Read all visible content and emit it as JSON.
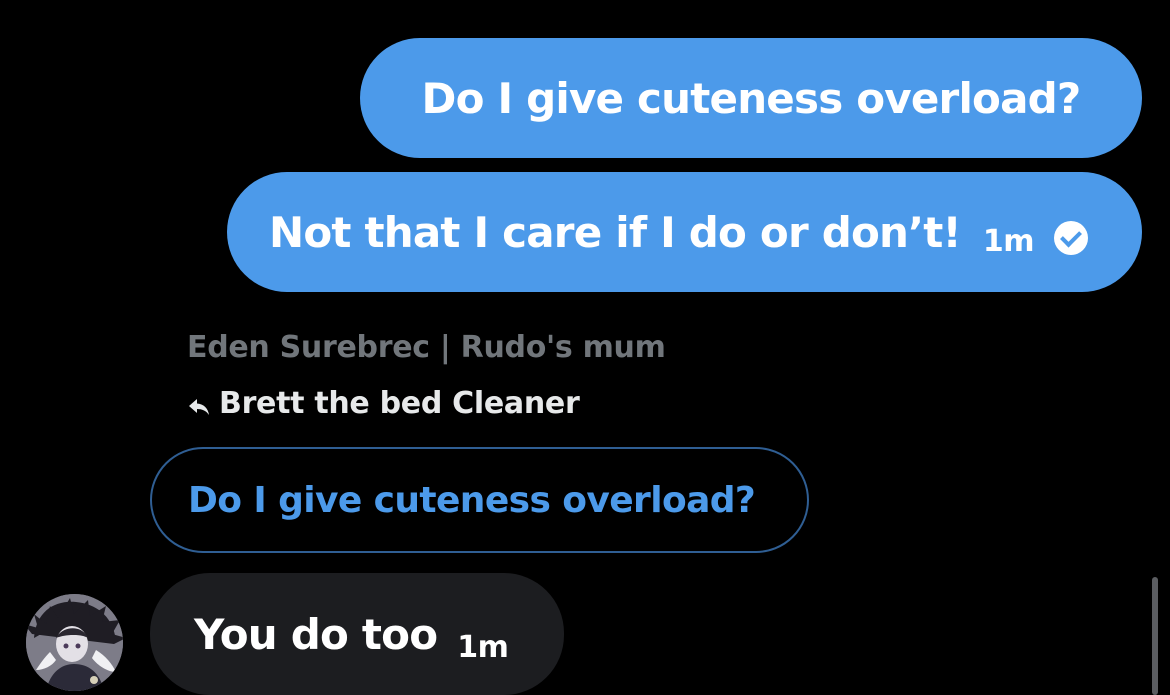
{
  "conversation": {
    "sent_messages": [
      {
        "text": "Do I give cuteness overload?"
      },
      {
        "text": "Not that I care if I do or don’t!",
        "time": "1m",
        "status_icon": "check-circle-icon"
      }
    ],
    "reply_block": {
      "sender": "Eden Surebrec | Rudo's mum",
      "reply_to_name": "Brett the bed Cleaner",
      "reply_icon": "reply-arrow-icon",
      "quoted_text": "Do I give cuteness overload?"
    },
    "received_message": {
      "text": "You do too",
      "time": "1m"
    }
  },
  "colors": {
    "background": "#000000",
    "sent_bubble": "#4c9aea",
    "received_bubble": "#1c1d20",
    "sender_name": "#71767b",
    "quote_border": "#2f5e93"
  }
}
